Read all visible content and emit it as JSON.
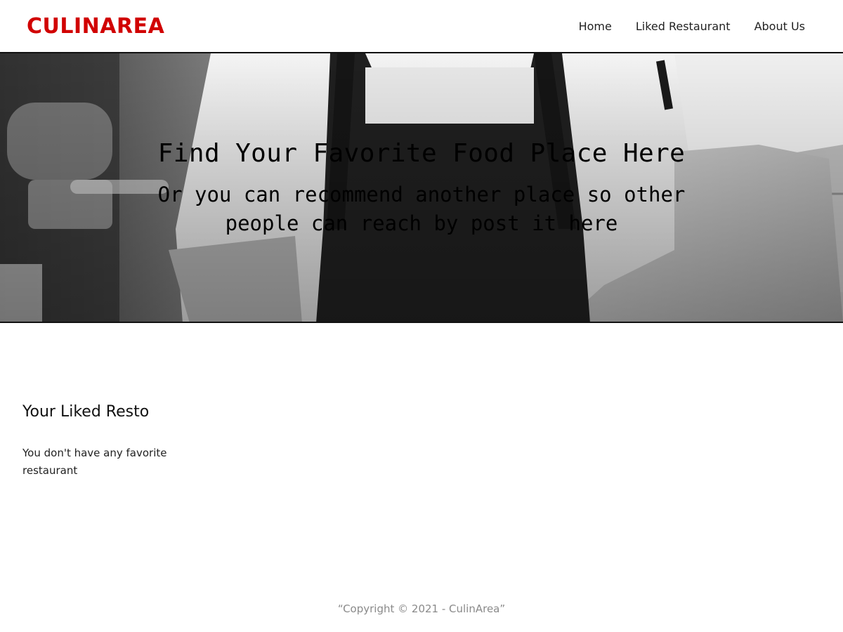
{
  "header": {
    "brand": "CULINAREA",
    "nav": [
      {
        "label": "Home"
      },
      {
        "label": "Liked Restaurant"
      },
      {
        "label": "About Us"
      }
    ]
  },
  "hero": {
    "title": "Find Your Favorite Food Place Here",
    "subtitle": "Or you can recommend another place so other people can reach by post it here"
  },
  "main": {
    "section_title": "Your Liked Resto",
    "empty_message": "You don't have any favorite restaurant"
  },
  "footer": {
    "copyright": "“Copyright © 2021 - CulinArea”"
  },
  "colors": {
    "brand": "#d10000",
    "footer_text": "#8a8a8a"
  }
}
